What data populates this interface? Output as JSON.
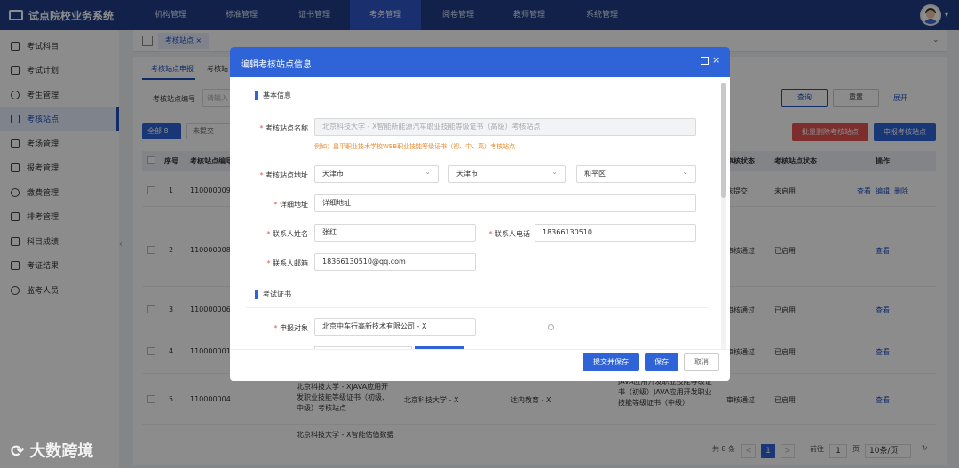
{
  "app": {
    "title": "试点院校业务系统"
  },
  "topnav": [
    "机构管理",
    "标准管理",
    "证书管理",
    "考务管理",
    "阅卷管理",
    "教师管理",
    "系统管理"
  ],
  "sidebar": [
    "考试科目",
    "考试计划",
    "考生管理",
    "考核站点",
    "考场管理",
    "报考管理",
    "缴费管理",
    "排考管理",
    "科目成绩",
    "考证结果",
    "监考人员"
  ],
  "tabs": {
    "active": "考核站点",
    "close": "×"
  },
  "subtabs": [
    "考核站点申报",
    "考核站"
  ],
  "filter": {
    "label": "考核站点编号",
    "placeholder": "请输入"
  },
  "buttons": {
    "query": "查询",
    "reset": "重置",
    "expand": "展开",
    "all": "全部",
    "all_count": "8",
    "notsub": "未提交",
    "batchdel": "批量删除考核站点",
    "apply": "申报考核站点"
  },
  "table": {
    "headers": [
      "序号",
      "考核站点编号",
      "审核状态",
      "考核站点状态",
      "操作"
    ],
    "rows": [
      {
        "no": "1",
        "code": "110000009",
        "audit": "未提交",
        "status": "未启用",
        "ops": [
          "查看",
          "编辑",
          "删除"
        ]
      },
      {
        "no": "2",
        "code": "110000008",
        "audit": "审核通过",
        "status": "已启用",
        "ops": [
          "查看"
        ]
      },
      {
        "no": "3",
        "code": "110000006",
        "audit": "审核通过",
        "status": "已启用",
        "ops": [
          "查看"
        ]
      },
      {
        "no": "4",
        "code": "110000001",
        "audit": "审核通过",
        "status": "已启用",
        "ops": [
          "查看"
        ]
      },
      {
        "no": "5",
        "code": "110000004",
        "name": "北京科技大学 - XJAVA应用开发职业技能等级证书（初级、中级）考核站点",
        "school": "北京科技大学 - X",
        "org": "达内教育 - X",
        "cert": "JAVA应用开发职业技能等级证书（初级）JAVA应用开发职业技能等级证书（中级）",
        "audit": "审核通过",
        "status": "已启用",
        "ops": [
          "查看"
        ]
      }
    ],
    "partial_row": "北京科技大学 - X智能估值数据"
  },
  "pagination": {
    "total": "共 8 条",
    "page": "1",
    "prev": "<",
    "next": ">",
    "goto": "前往",
    "goto_page": "1",
    "goto_unit": "页",
    "size": "10条/页"
  },
  "modal": {
    "title": "编辑考核站点信息",
    "sec_basic": "基本信息",
    "name_label": "考核站点名称",
    "name_value": "北京科技大学 - X智能新能源汽车职业技能等级证书（高级）考核站点",
    "hint": "例如：昌平职业技术学校WEB职业技能等级证书（初、中、高）考核站点",
    "addr_label": "考核站点地址",
    "province": "天津市",
    "city": "天津市",
    "district": "和平区",
    "detail_label": "详细地址",
    "detail_value": "详细地址",
    "contact_label": "联系人姓名",
    "contact_value": "张红",
    "phone_label": "联系人电话",
    "phone_value": "18366130510",
    "email_label": "联系人邮箱",
    "email_value": "18366130510@qq.com",
    "sec_cert": "考试证书",
    "apply_label": "申报对象",
    "apply_value": "北京中车行高新技术有限公司 - X",
    "submit": "提交并保存",
    "save": "保存",
    "cancel": "取消"
  },
  "watermark": "大数跨境"
}
